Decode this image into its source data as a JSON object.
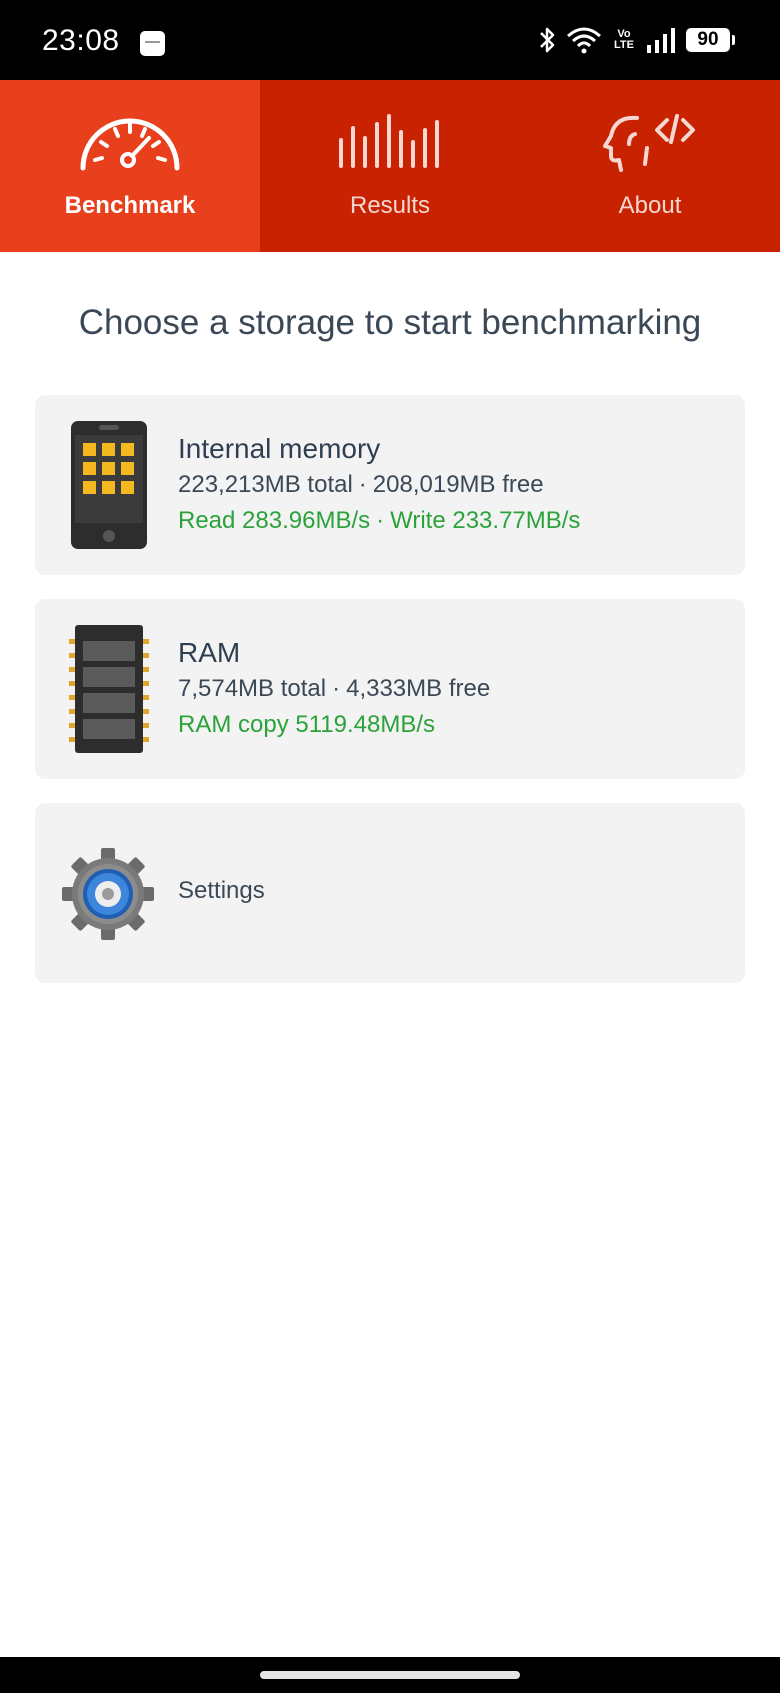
{
  "status_bar": {
    "time": "23:08",
    "volte_top": "Vo",
    "volte_bottom": "LTE",
    "battery": "90"
  },
  "tabs": [
    {
      "label": "Benchmark",
      "icon": "speedometer-icon",
      "active": true
    },
    {
      "label": "Results",
      "icon": "bars-icon",
      "active": false
    },
    {
      "label": "About",
      "icon": "head-code-icon",
      "active": false
    }
  ],
  "colors": {
    "tab_bar": "#c92201",
    "tab_active": "#e8401c",
    "speed_text": "#2ba23a",
    "card_bg": "#f3f3f3"
  },
  "main": {
    "heading": "Choose a storage to start benchmarking",
    "cards": [
      {
        "title": "Internal memory",
        "total": "223,213MB total",
        "free": "208,019MB free",
        "read": "Read 283.96MB/s",
        "write": "Write 233.77MB/s",
        "icon": "phone-icon"
      },
      {
        "title": "RAM",
        "total": "7,574MB total",
        "free": "4,333MB free",
        "copy": "RAM copy 5119.48MB/s",
        "icon": "ram-chip-icon"
      },
      {
        "title": "Settings",
        "icon": "gear-icon"
      }
    ]
  }
}
